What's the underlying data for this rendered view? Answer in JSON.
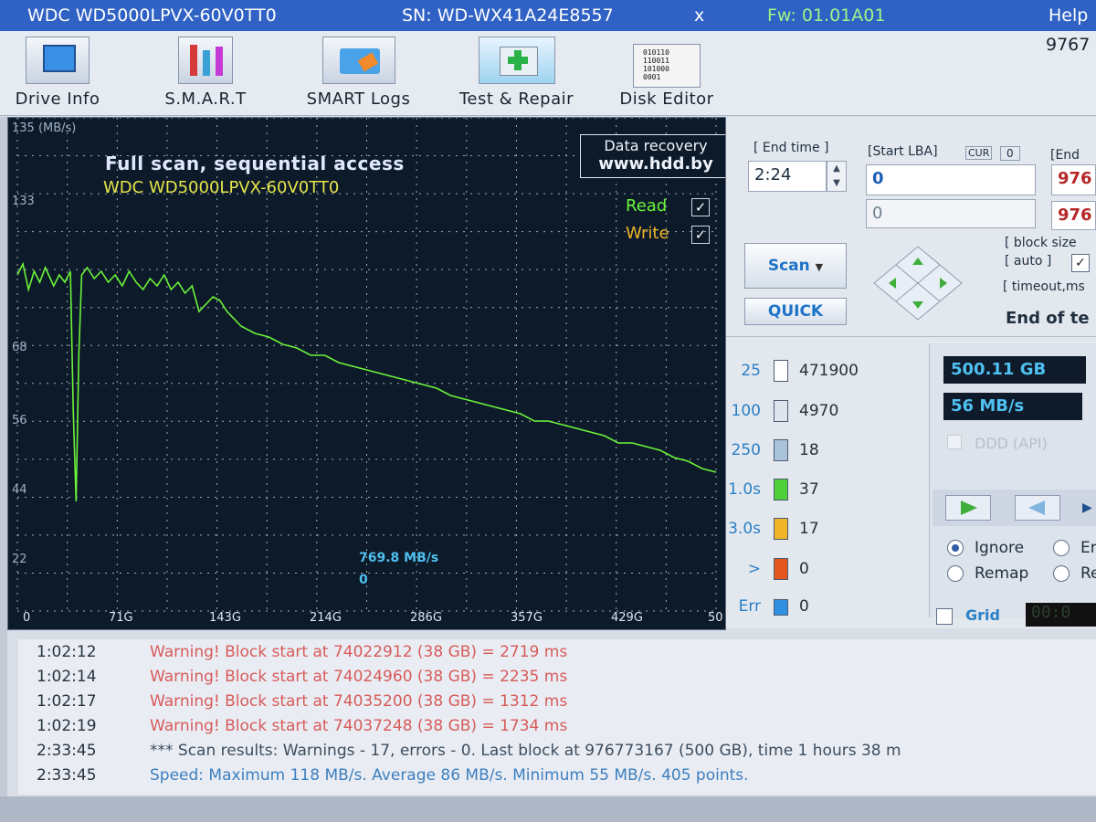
{
  "titlebar": {
    "model": "WDC WD5000LPVX-60V0TT0",
    "serial": "SN: WD-WX41A24E8557",
    "close": "x",
    "firmware": "Fw: 01.01A01",
    "help": "Help",
    "lba_partial": "9767"
  },
  "toolbar": {
    "drive_info": "Drive Info",
    "smart": "S.M.A.R.T",
    "smart_logs": "SMART Logs",
    "test_repair": "Test & Repair",
    "disk_editor": "Disk Editor",
    "disk_editor_icon_text": "010110\n110011\n101000\n0001"
  },
  "graph": {
    "ymax_label": "135 (MB/s)",
    "title": "Full scan, sequential access",
    "model": "WDC WD5000LPVX-60V0TT0",
    "watermark_line1": "Data recovery",
    "watermark_line2": "www.hdd.by",
    "read_label": "Read",
    "write_label": "Write",
    "read_checked": true,
    "write_checked": true,
    "cursor_speed": "769.8 MB/s",
    "cursor_pos": "0",
    "y_ticks": [
      "133",
      "68",
      "56",
      "44",
      "22"
    ],
    "x_ticks": [
      "0",
      "71G",
      "143G",
      "214G",
      "286G",
      "357G",
      "429G",
      "50"
    ],
    "colors": {
      "background": "#0d1a29",
      "grid": "#d6dde6",
      "line": "#6bf43a",
      "title": "#dfe8ff",
      "model": "#e6e64a"
    }
  },
  "chart_data": {
    "type": "line",
    "title": "Full scan, sequential access",
    "ylabel": "MB/s",
    "xlabel": "",
    "x_unit": "GB",
    "ylim": [
      0,
      135
    ],
    "xlim": [
      0,
      500
    ],
    "grid": true,
    "series": [
      {
        "name": "Read",
        "x": [
          0,
          4,
          8,
          12,
          16,
          20,
          26,
          30,
          34,
          38,
          40,
          42,
          44,
          46,
          50,
          55,
          60,
          65,
          70,
          75,
          80,
          85,
          90,
          95,
          100,
          105,
          110,
          115,
          120,
          125,
          130,
          135,
          140,
          145,
          150,
          155,
          160,
          170,
          180,
          190,
          200,
          210,
          220,
          230,
          240,
          250,
          260,
          270,
          280,
          290,
          300,
          310,
          320,
          330,
          340,
          350,
          360,
          370,
          380,
          390,
          400,
          410,
          420,
          430,
          440,
          450,
          460,
          470,
          480,
          490,
          500
        ],
        "y": [
          92,
          95,
          88,
          93,
          90,
          94,
          89,
          92,
          90,
          93,
          55,
          30,
          70,
          92,
          94,
          91,
          93,
          90,
          92,
          89,
          93,
          90,
          88,
          91,
          89,
          92,
          88,
          90,
          87,
          89,
          82,
          84,
          86,
          85,
          82,
          80,
          78,
          76,
          75,
          73,
          72,
          70,
          70,
          68,
          67,
          66,
          65,
          64,
          63,
          62,
          61,
          59,
          58,
          57,
          56,
          55,
          54,
          52,
          52,
          51,
          50,
          49,
          48,
          46,
          46,
          45,
          44,
          42,
          41,
          39,
          38
        ]
      }
    ]
  },
  "controls": {
    "end_time_label": "[ End time ]",
    "end_time_value": "2:24",
    "start_lba_label": "[Start LBA]",
    "cur_label": "CUR",
    "cur_value": "0",
    "end_lba_label": "[End",
    "start_lba_value": "0",
    "start_lba_value2": "0",
    "end_lba_value": "976",
    "end_lba_value2": "976",
    "scan_button": "Scan",
    "quick_button": "QUICK",
    "block_size_label": "[ block size",
    "auto_label": "[ auto ]",
    "timeout_label": "[ timeout,ms",
    "end_of_test_label": "End of te"
  },
  "legend": [
    {
      "label": "25",
      "count": "471900",
      "color": "#ffffff"
    },
    {
      "label": "100",
      "count": "4970",
      "color": "#dfe5ec"
    },
    {
      "label": "250",
      "count": "18",
      "color": "#a9c3da"
    },
    {
      "label": "1.0s",
      "count": "37",
      "color": "#4fcf39"
    },
    {
      "label": "3.0s",
      "count": "17",
      "color": "#f0b42a"
    },
    {
      "label": ">",
      "count": "0",
      "color": "#e3571f"
    },
    {
      "label": "Err",
      "count": "0",
      "color": "#2f8fe0"
    }
  ],
  "stats": {
    "capacity": "500.11 GB",
    "speed": "56 MB/s",
    "ddd_label": "DDD (API)",
    "ignore": "Ignore",
    "er_partial": "Er",
    "remap": "Remap",
    "re_partial": "Re",
    "grid": "Grid",
    "timer": "00:0"
  },
  "log": [
    {
      "time": "1:02:12",
      "message": "Warning! Block start at 74022912 (38 GB)  = 2719 ms",
      "type": "warn"
    },
    {
      "time": "1:02:14",
      "message": "Warning! Block start at 74024960 (38 GB)  = 2235 ms",
      "type": "warn"
    },
    {
      "time": "1:02:17",
      "message": "Warning! Block start at 74035200 (38 GB)  = 1312 ms",
      "type": "warn"
    },
    {
      "time": "1:02:19",
      "message": "Warning! Block start at 74037248 (38 GB)  = 1734 ms",
      "type": "warn"
    },
    {
      "time": "2:33:45",
      "message": "*** Scan results: Warnings - 17, errors - 0. Last block at 976773167 (500 GB), time 1 hours 38 m",
      "type": "info"
    },
    {
      "time": "2:33:45",
      "message": "Speed: Maximum 118 MB/s. Average 86 MB/s. Minimum 55 MB/s. 405 points.",
      "type": "speed"
    }
  ]
}
